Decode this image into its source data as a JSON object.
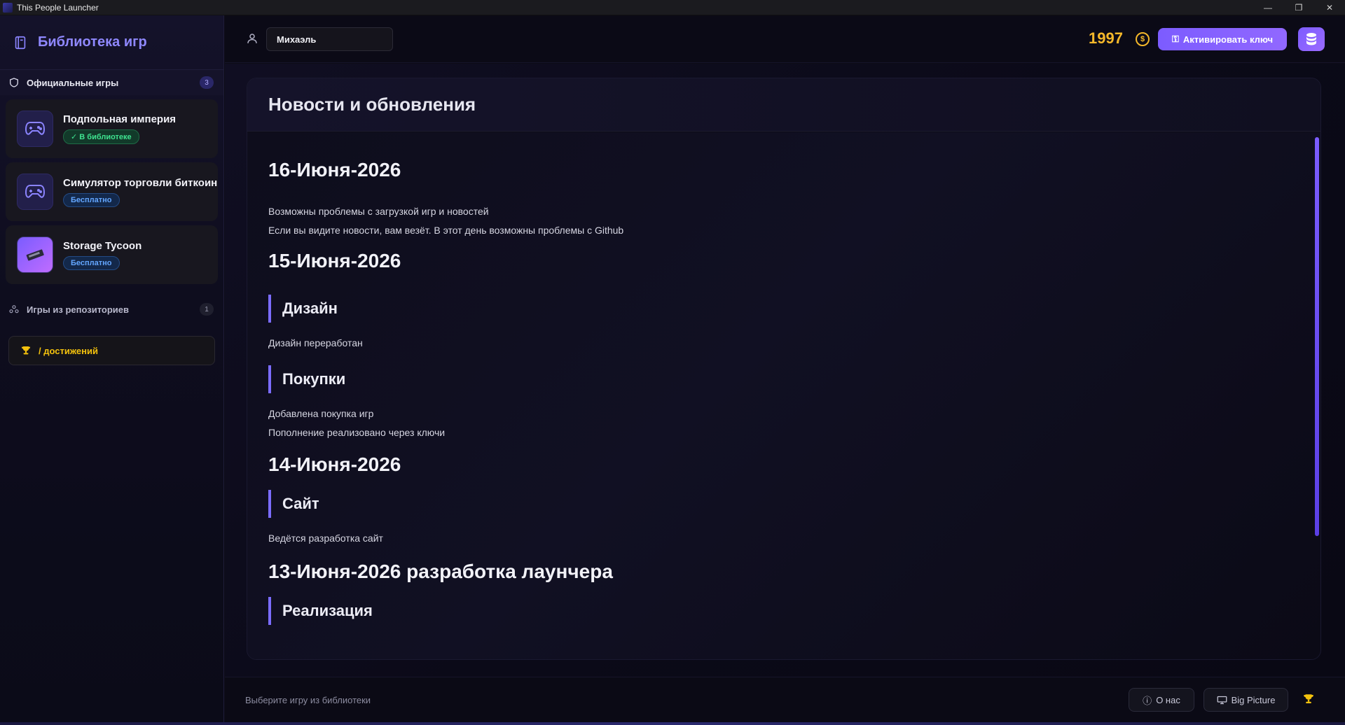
{
  "window": {
    "title": "This People Launcher",
    "controls": [
      "—",
      "❐",
      "✕"
    ]
  },
  "sidebar": {
    "title": "Библиотека игр",
    "icon": "book-icon",
    "official": {
      "label": "Официальные игры",
      "count": "3",
      "icon": "shield-icon"
    },
    "games": [
      {
        "name": "Подпольная империя",
        "badge": "✓ В библиотеке",
        "badge_type": "owned",
        "icon": "gamepad-icon"
      },
      {
        "name": "Симулятор торговли биткоинами",
        "badge": "Бесплатно",
        "badge_type": "free",
        "icon": "gamepad-icon"
      },
      {
        "name": "Storage Tycoon",
        "badge": "Бесплатно",
        "badge_type": "free",
        "icon": "game-cover-image"
      }
    ],
    "repos": {
      "label": "Игры из репозиториев",
      "count": "1",
      "icon": "repos-icon"
    },
    "achievements": {
      "label": "/ достижений",
      "icon": "trophy-icon"
    }
  },
  "topbar": {
    "username": "Михаэль",
    "coins": "1997",
    "coin_symbol": "$",
    "activate_label": "Активировать ключ",
    "activate_icon": "key-icon",
    "db_icon": "database-icon"
  },
  "news": {
    "title": "Новости и обновления",
    "entries": [
      {
        "date": "16-Июня-2026",
        "lines": [
          "Возможны проблемы с загрузкой игр и новостей",
          "Если вы видите новости, вам везёт. В этот день возможны проблемы с Github"
        ]
      },
      {
        "date": "15-Июня-2026",
        "sections": [
          {
            "heading": "Дизайн",
            "lines": [
              "Дизайн переработан"
            ]
          },
          {
            "heading": "Покупки",
            "lines": [
              "Добавлена покупка игр",
              "Пополнение реализовано через ключи"
            ]
          }
        ]
      },
      {
        "date": "14-Июня-2026",
        "sections": [
          {
            "heading": "Сайт",
            "lines": [
              "Ведётся разработка сайт"
            ]
          }
        ]
      },
      {
        "date": "13-Июня-2026 разработка лаунчера",
        "sections": [
          {
            "heading": "Реализация",
            "lines": []
          }
        ]
      }
    ]
  },
  "bottombar": {
    "status": "Выберите игру из библиотеки",
    "about_label": "О нас",
    "bigpicture_label": "Big Picture"
  },
  "colors": {
    "accent": "#7c5cff",
    "coins": "#f5b82a",
    "owned_badge": "#3ee28f",
    "free_badge": "#63a6ff",
    "trophy": "#f4c20d"
  }
}
